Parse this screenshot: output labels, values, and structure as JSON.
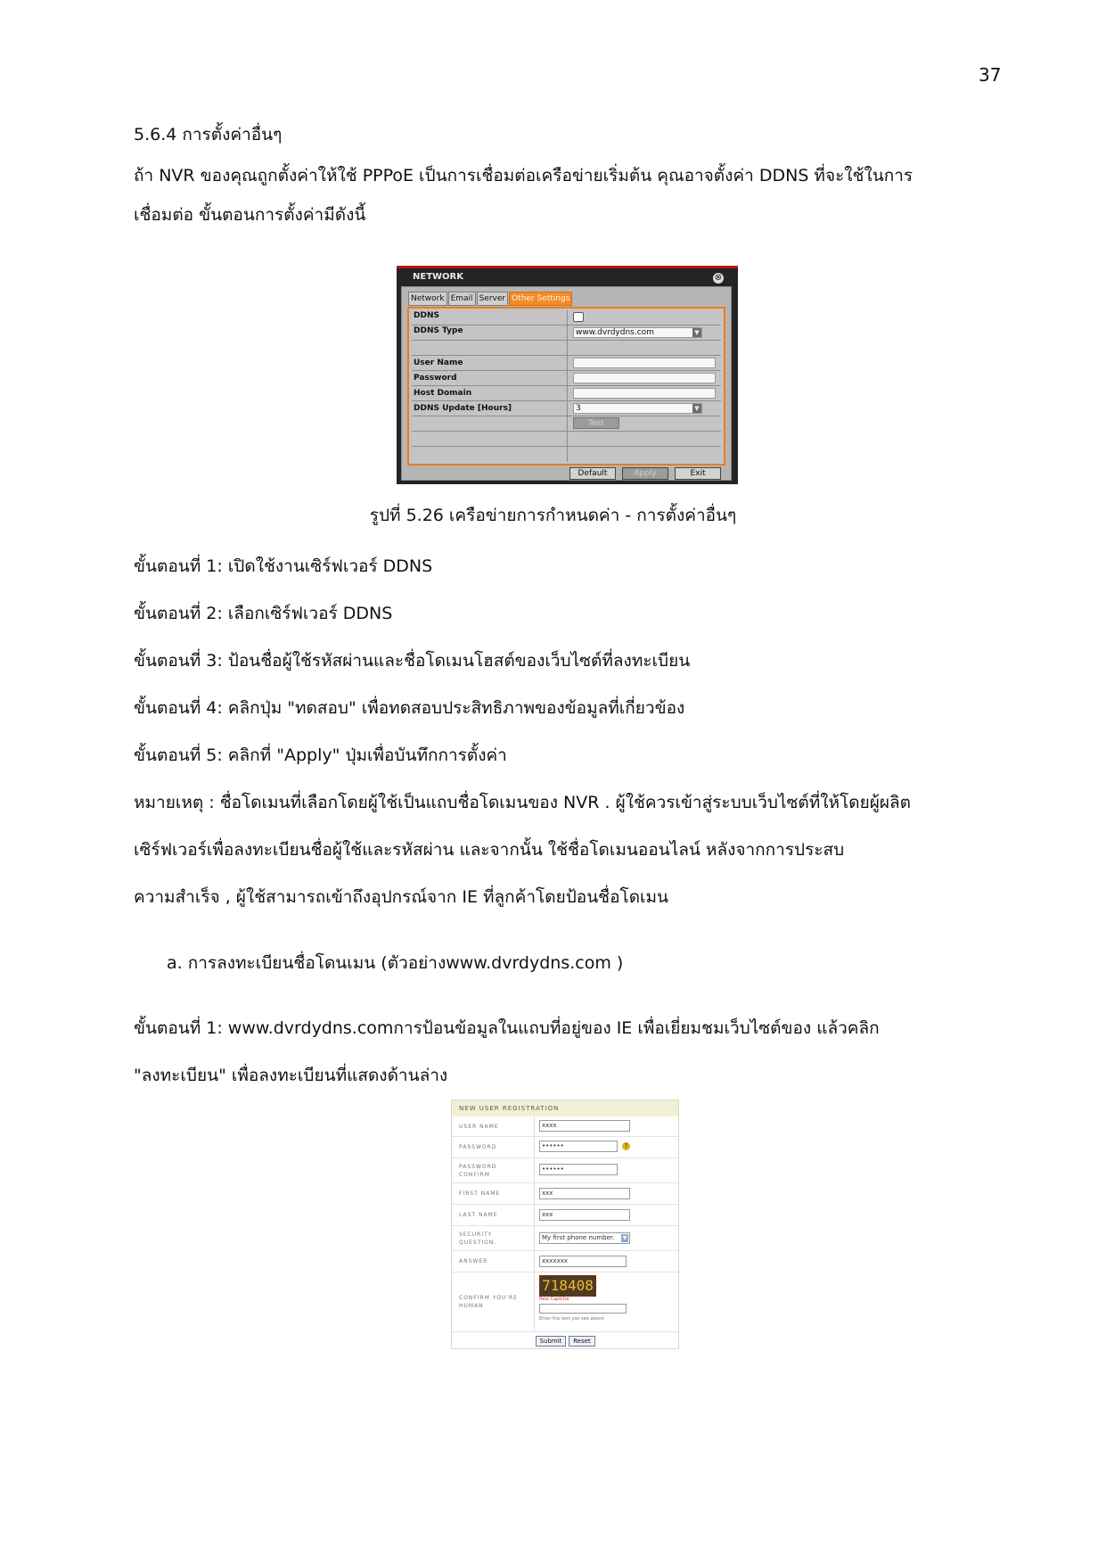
{
  "page_number": "37",
  "section_title": "5.6.4 การตั้งค่าอื่นๆ",
  "intro_line1": "ถ้า NVR ของคุณถูกตั้งค่าให้ใช้ PPPoE เป็นการเชื่อมต่อเครือข่ายเริ่มต้น คุณอาจตั้งค่า DDNS ที่จะใช้ในการ",
  "intro_line2": "เชื่อมต่อ ขั้นตอนการตั้งค่ามีดังนี้",
  "nvr_dialog": {
    "title": "NETWORK",
    "close_glyph": "⊗",
    "tabs": [
      "Network",
      "Email",
      "Server",
      "Other Settings"
    ],
    "rows": {
      "ddns": "DDNS",
      "ddns_type": "DDNS Type",
      "user_name": "User Name",
      "password": "Password",
      "host_domain": "Host Domain",
      "update": "DDNS Update [Hours]"
    },
    "ddns_type_value": "www.dvrdydns.com",
    "update_value": "3",
    "select_arrow": "▼",
    "test_button": "Test",
    "buttons": {
      "default": "Default",
      "apply": "Apply",
      "exit": "Exit"
    }
  },
  "figure_caption": "รูปที่ 5.26 เครือข่ายการกำหนดค่า - การตั้งค่าอื่นๆ",
  "steps": [
    "ขั้นตอนที่ 1: เปิดใช้งานเซิร์ฟเวอร์ DDNS",
    "ขั้นตอนที่ 2: เลือกเซิร์ฟเวอร์ DDNS",
    "ขั้นตอนที่ 3: ป้อนชื่อผู้ใช้รหัสผ่านและชื่อโดเมนโฮสต์ของเว็บไซต์ที่ลงทะเบียน",
    "ขั้นตอนที่ 4: คลิกปุ่ม \"ทดสอบ\" เพื่อทดสอบประสิทธิภาพของข้อมูลที่เกี่ยวข้อง",
    "ขั้นตอนที่ 5: คลิกที่ \"Apply\" ปุ่มเพื่อบันทึกการตั้งค่า"
  ],
  "note_lines": [
    "หมายเหตุ : ชื่อโดเมนที่เลือกโดยผู้ใช้เป็นแถบชื่อโดเมนของ NVR . ผู้ใช้ควรเข้าสู่ระบบเว็บไซต์ที่ให้โดยผู้ผลิต",
    "เซิร์ฟเวอร์เพื่อลงทะเบียนชื่อผู้ใช้และรหัสผ่าน และจากนั้น ใช้ชื่อโดเมนออนไลน์ หลังจากการประสบ",
    "ความสำเร็จ , ผู้ใช้สามารถเข้าถึงอุปกรณ์จาก IE ที่ลูกค้าโดยป้อนชื่อโดเมน"
  ],
  "sub_item": "a.   การลงทะเบียนชื่อโดนเมน (ตัวอย่างwww.dvrdydns.com )",
  "step_b_line1": "ขั้นตอนที่ 1: www.dvrdydns.comการป้อนข้อมูลในแถบที่อยู่ของ IE เพื่อเยี่ยมชมเว็บไซต์ของ แล้วคลิก",
  "step_b_line2": "\"ลงทะเบียน\" เพื่อลงทะเบียนที่แสดงด้านล่าง",
  "registration": {
    "header": "NEW USER REGISTRATION",
    "labels": {
      "user_name": "USER NAME",
      "password": "PASSWORD",
      "password_confirm_1": "PASSWORD",
      "password_confirm_2": "CONFIRM",
      "first_name": "FIRST NAME",
      "last_name": "LAST NAME",
      "security_1": "SECURITY",
      "security_2": "QUESTION.",
      "answer": "ANSWER",
      "human_1": "CONFIRM YOU'RE",
      "human_2": "HUMAN"
    },
    "values": {
      "user_name": "xxxx",
      "password": "••••••",
      "password_confirm": "••••••",
      "first_name": "xxx",
      "last_name": "xxx",
      "security_question": "My first phone number.",
      "answer": "xxxxxxx"
    },
    "help_glyph": "?",
    "captcha": "718408",
    "new_captcha": "New Captcha",
    "captcha_hint": "Enter the text you see above",
    "submit": "Submit",
    "reset": "Reset"
  }
}
